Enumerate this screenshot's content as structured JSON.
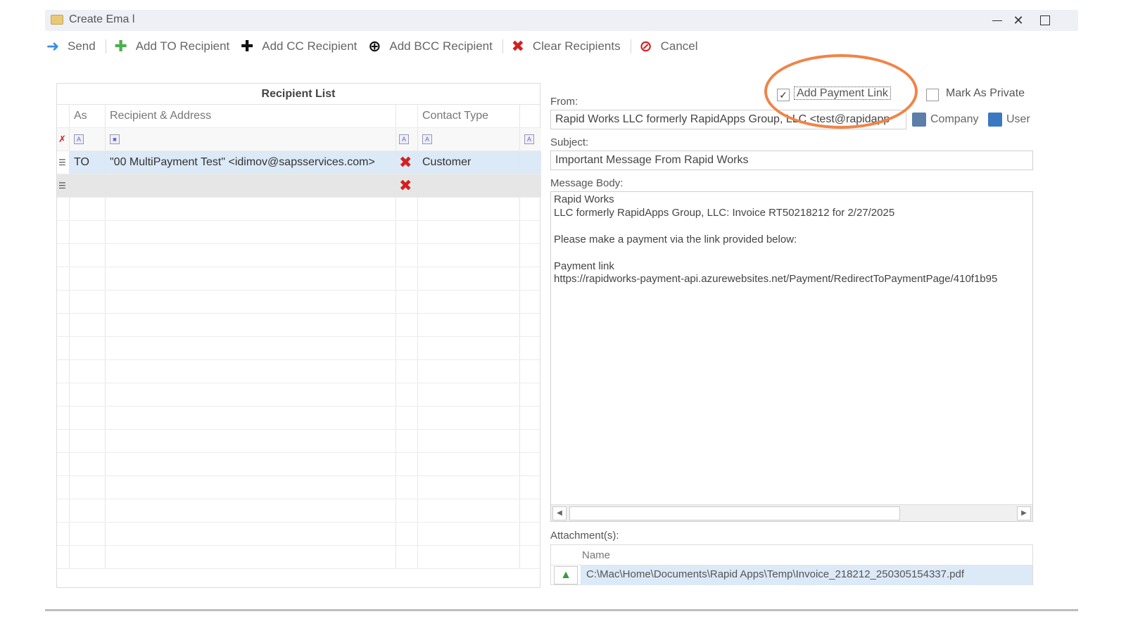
{
  "window": {
    "title": "Create Ema l"
  },
  "toolbar": {
    "send": "Send",
    "add_to": "Add TO Recipient",
    "add_cc": "Add CC Recipient",
    "add_bcc": "Add BCC Recipient",
    "clear": "Clear Recipients",
    "cancel": "Cancel"
  },
  "recipient_list": {
    "title": "Recipient List",
    "columns": {
      "as": "As",
      "recipient": "Recipient & Address",
      "contact_type": "Contact Type"
    },
    "rows": [
      {
        "as": "TO",
        "recipient": "\"00 MultiPayment Test\" <idimov@sapsservices.com>",
        "contact_type": "Customer"
      }
    ]
  },
  "options": {
    "add_payment_link": "Add Payment Link",
    "mark_private": "Mark As Private"
  },
  "from": {
    "label": "From:",
    "value": "Rapid Works  LLC formerly RapidApps Group, LLC <test@rapidapp",
    "company": "Company",
    "user": "User"
  },
  "subject": {
    "label": "Subject:",
    "value": "Important Message From Rapid Works"
  },
  "message": {
    "label": "Message Body:",
    "lines": [
      "Rapid Works",
      "LLC formerly RapidApps Group, LLC: Invoice RT50218212 for 2/27/2025",
      "Please make a payment via the link provided below:",
      "Payment link",
      "https://rapidworks-payment-api.azurewebsites.net/Payment/RedirectToPaymentPage/410f1b95"
    ]
  },
  "attachments": {
    "label": "Attachment(s):",
    "column": "Name",
    "rows": [
      "C:\\Mac\\Home\\Documents\\Rapid  Apps\\Temp\\Invoice_218212_250305154337.pdf"
    ]
  },
  "colors": {
    "highlight": "#f08448",
    "selected_row": "#dce9f7",
    "delete": "#d42020"
  }
}
